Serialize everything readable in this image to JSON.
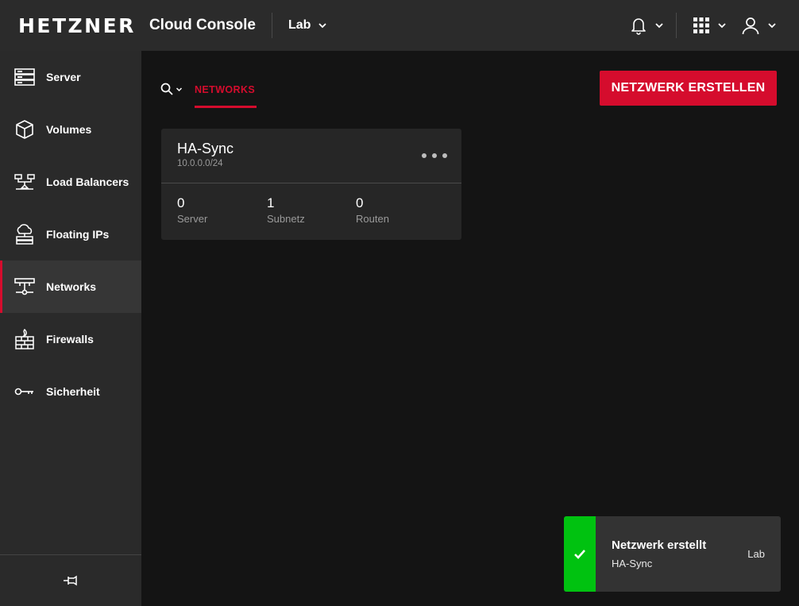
{
  "header": {
    "logo": "HETZNER",
    "product": "Cloud Console",
    "project": "Lab",
    "icons": [
      "bell-icon",
      "apps-grid-icon",
      "user-icon"
    ]
  },
  "sidebar": {
    "items": [
      {
        "label": "Server",
        "icon": "server-icon"
      },
      {
        "label": "Volumes",
        "icon": "cube-icon"
      },
      {
        "label": "Load Balancers",
        "icon": "load-balancer-icon"
      },
      {
        "label": "Floating IPs",
        "icon": "floating-ip-icon"
      },
      {
        "label": "Networks",
        "icon": "network-icon",
        "active": true
      },
      {
        "label": "Firewalls",
        "icon": "firewall-icon"
      },
      {
        "label": "Sicherheit",
        "icon": "key-icon"
      }
    ],
    "footer_icon": "pin-icon"
  },
  "main": {
    "tab": "NETWORKS",
    "create_button": "NETZWERK ERSTELLEN",
    "networks": [
      {
        "name": "HA-Sync",
        "cidr": "10.0.0.0/24",
        "stats": [
          {
            "value": "0",
            "label": "Server"
          },
          {
            "value": "1",
            "label": "Subnetz"
          },
          {
            "value": "0",
            "label": "Routen"
          }
        ]
      }
    ]
  },
  "toast": {
    "title": "Netzwerk erstellt",
    "subtitle": "HA-Sync",
    "project": "Lab",
    "status_color": "#00c210"
  },
  "colors": {
    "accent": "#d50c2d",
    "header_bg": "#2b2b2b",
    "sidebar_bg": "#2a2a2a",
    "main_bg": "#141414",
    "card_bg": "#262626"
  }
}
